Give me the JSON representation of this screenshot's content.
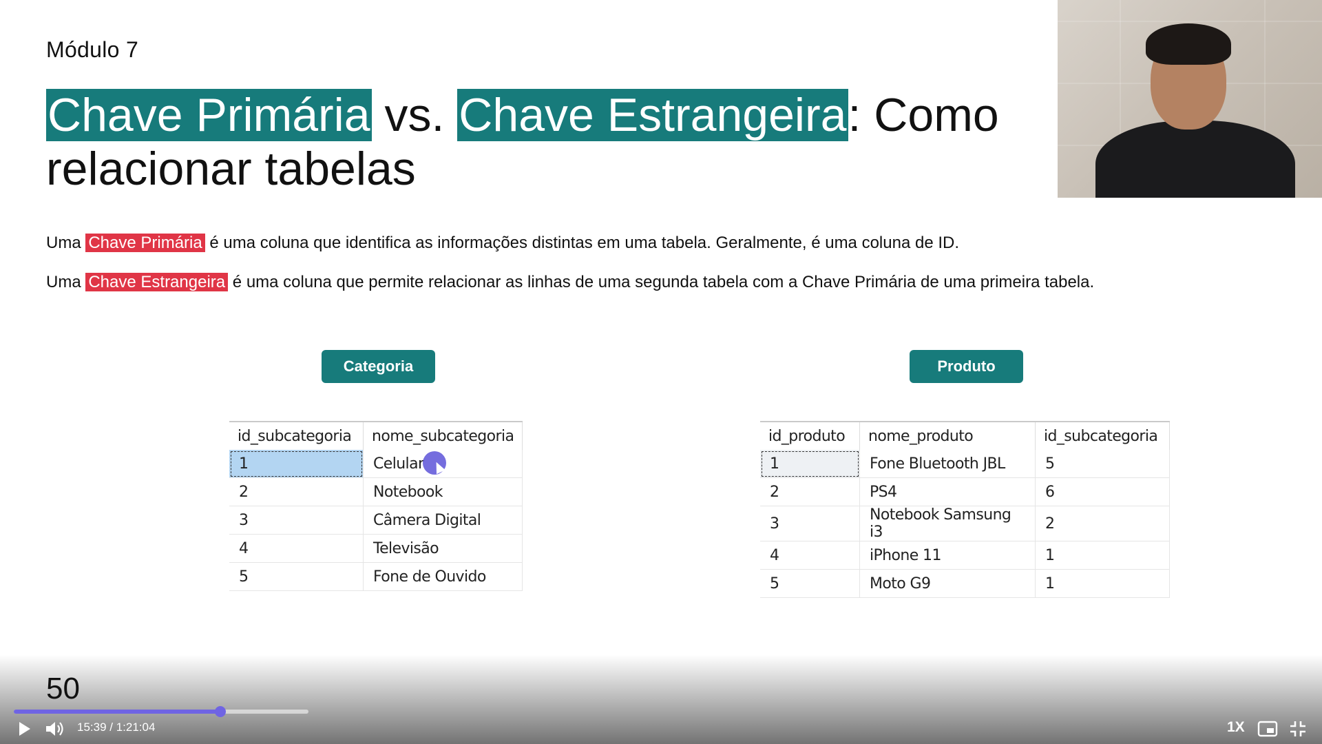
{
  "slide": {
    "module": "Módulo 7",
    "title": {
      "hl1": "Chave Primária",
      "vs": " vs. ",
      "hl2": "Chave Estrangeira",
      "rest": ": Como relacionar tabelas"
    },
    "p1": {
      "pre": "Uma ",
      "hl": "Chave Primária",
      "post": "é uma coluna que identifica as informações distintas em uma tabela. Geralmente, é uma coluna de ID."
    },
    "p2": {
      "pre": "Uma ",
      "hl": "Chave Estrangeira",
      "post": "é uma coluna que permite relacionar as linhas de uma segunda tabela com a Chave Primária de uma primeira tabela."
    },
    "tables": {
      "categoria": {
        "label": "Categoria",
        "headers": [
          "id_subcategoria",
          "nome_subcategoria"
        ],
        "rows": [
          [
            "1",
            "Celular"
          ],
          [
            "2",
            "Notebook"
          ],
          [
            "3",
            "Câmera Digital"
          ],
          [
            "4",
            "Televisão"
          ],
          [
            "5",
            "Fone de Ouvido"
          ]
        ]
      },
      "produto": {
        "label": "Produto",
        "headers": [
          "id_produto",
          "nome_produto",
          "id_subcategoria"
        ],
        "rows": [
          [
            "1",
            "Fone Bluetooth JBL",
            "5"
          ],
          [
            "2",
            "PS4",
            "6"
          ],
          [
            "3",
            "Notebook Samsung i3",
            "2"
          ],
          [
            "4",
            "iPhone 11",
            "1"
          ],
          [
            "5",
            "Moto G9",
            "1"
          ]
        ]
      }
    }
  },
  "player": {
    "chapter_number": "50",
    "time": "15:39 / 1:21:04",
    "progress": 0.7,
    "speed": "1X",
    "icons": {
      "play": "play-icon",
      "volume": "volume-icon",
      "pip": "picture-in-picture-icon",
      "exit_fullscreen": "exit-fullscreen-icon"
    },
    "accent": "#6f64e3"
  },
  "colors": {
    "teal": "#177b7b",
    "red": "#e03546"
  }
}
